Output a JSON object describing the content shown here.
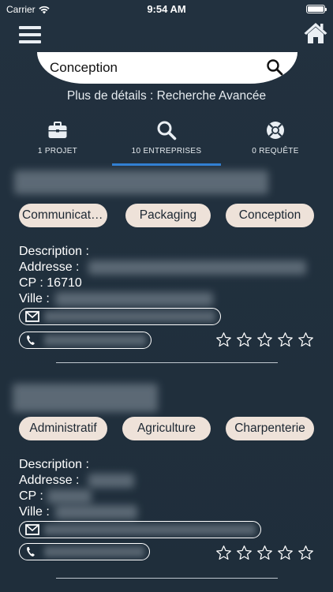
{
  "status_bar": {
    "carrier": "Carrier",
    "time": "9:54 AM"
  },
  "header": {
    "menu_icon": "hamburger-menu-icon",
    "home_icon": "home-icon"
  },
  "search": {
    "value": "Conception",
    "icon": "search-icon"
  },
  "advanced_link": "Plus de détails : Recherche Avancée",
  "tabs": [
    {
      "label": "1 PROJET",
      "icon": "briefcase-icon"
    },
    {
      "label": "10 ENTREPRISES",
      "icon": "search-icon",
      "active": true
    },
    {
      "label": "0 REQUÊTE",
      "icon": "lifebuoy-icon"
    }
  ],
  "colors": {
    "background": "#22313f",
    "tag_bg": "#eee2d9",
    "accent": "#2f7fd4"
  },
  "results": [
    {
      "tags": [
        "Communicati…",
        "Packaging",
        "Conception"
      ],
      "description_label": "Description :",
      "address_label": "Addresse :",
      "cp_label": "CP : 16710",
      "city_label": "Ville :",
      "rating": 0
    },
    {
      "tags": [
        "Administratif",
        "Agriculture",
        "Charpenterie"
      ],
      "description_label": "Description :",
      "address_label": "Addresse :",
      "cp_label": "CP :",
      "city_label": "Ville :",
      "rating": 0
    }
  ]
}
